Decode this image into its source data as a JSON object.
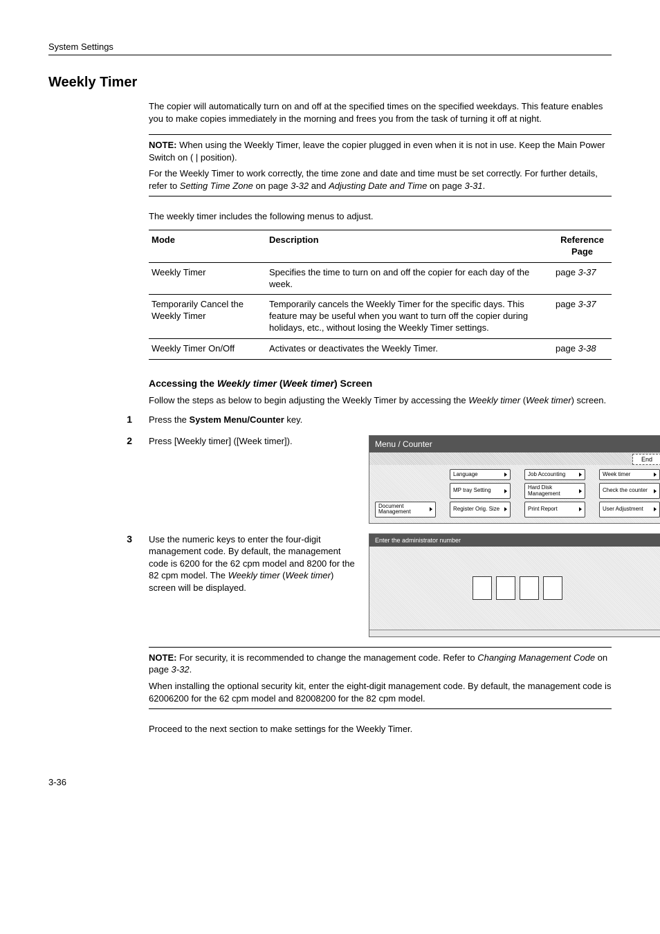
{
  "runningHead": "System Settings",
  "sectionTitle": "Weekly Timer",
  "intro": "The copier will automatically turn on and off at the specified times on the specified weekdays. This feature enables you to make copies immediately in the morning and frees you from the task of turning it off at night.",
  "note1": {
    "label": "NOTE:",
    "p1": " When using the Weekly Timer, leave the copier plugged in even when it is not in use. Keep the Main Power Switch on ( | position).",
    "p2a": "For the Weekly Timer to work correctly, the time zone and date and time must be set correctly. For further details, refer to ",
    "p2i1": "Setting Time Zone",
    "p2b": " on page ",
    "p2pg1": "3-32",
    "p2c": " and ",
    "p2i2": "Adjusting Date and Time",
    "p2d": " on page ",
    "p2pg2": "3-31",
    "p2e": "."
  },
  "tableIntro": "The weekly timer includes the following menus to adjust.",
  "tableHead": {
    "mode": "Mode",
    "desc": "Description",
    "ref1": "Reference",
    "ref2": "Page"
  },
  "rows": [
    {
      "mode": "Weekly Timer",
      "desc": "Specifies the time to turn on and off the copier for each day of the week.",
      "refPre": "page ",
      "refPage": "3-37"
    },
    {
      "mode": "Temporarily Cancel the Weekly Timer",
      "desc": "Temporarily cancels the Weekly Timer for the specific days. This feature may be useful when you want to turn off the copier during holidays, etc., without losing the Weekly Timer settings.",
      "refPre": "page ",
      "refPage": "3-37"
    },
    {
      "mode": "Weekly Timer On/Off",
      "desc": "Activates or deactivates the Weekly Timer.",
      "refPre": "page ",
      "refPage": "3-38"
    }
  ],
  "subhead": {
    "a": "Accessing the ",
    "i1": "Weekly timer",
    "b": " (",
    "i2": "Week timer",
    "c": ") Screen"
  },
  "subheadPara": {
    "a": "Follow the steps as below to begin adjusting the Weekly Timer by accessing the ",
    "i1": "Weekly timer",
    "b": " (",
    "i2": "Week timer",
    "c": ") screen."
  },
  "steps": {
    "s1": {
      "num": "1",
      "a": "Press the ",
      "b": "System Menu/Counter",
      "c": " key."
    },
    "s2": {
      "num": "2",
      "text": "Press [Weekly timer] ([Week timer])."
    },
    "s3": {
      "num": "3",
      "a": "Use the numeric keys to enter the four-digit management code. By default, the management code is 6200 for the 62 cpm model and 8200 for the 82 cpm model. The ",
      "i1": "Weekly timer",
      "b": " (",
      "i2": "Week timer",
      "c": ") screen will be displayed."
    }
  },
  "screen1": {
    "title": "Menu / Counter",
    "end": "End",
    "buttons": {
      "language": "Language",
      "jobAccounting": "Job Accounting",
      "weekTimer": "Week timer",
      "mpTray": "MP tray Setting",
      "hardDisk": "Hard Disk Management",
      "checkCounter": "Check the counter",
      "document": "Document Management",
      "register": "Register Orig. Size",
      "printReport": "Print Report",
      "userAdjust": "User Adjustment"
    }
  },
  "screen2": {
    "title": "Enter the administrator number"
  },
  "note2": {
    "label": "NOTE:",
    "p1a": " For security, it is recommended to change the management code. Refer to ",
    "p1i": "Changing Management Code",
    "p1b": " on page ",
    "p1pg": "3-32",
    "p1c": ".",
    "p2": "When installing the optional security kit, enter the eight-digit management code. By default, the management code is 62006200 for the 62 cpm model and 82008200 for the 82 cpm model."
  },
  "closing": "Proceed to the next section to make settings for the Weekly Timer.",
  "pageNum": "3-36"
}
